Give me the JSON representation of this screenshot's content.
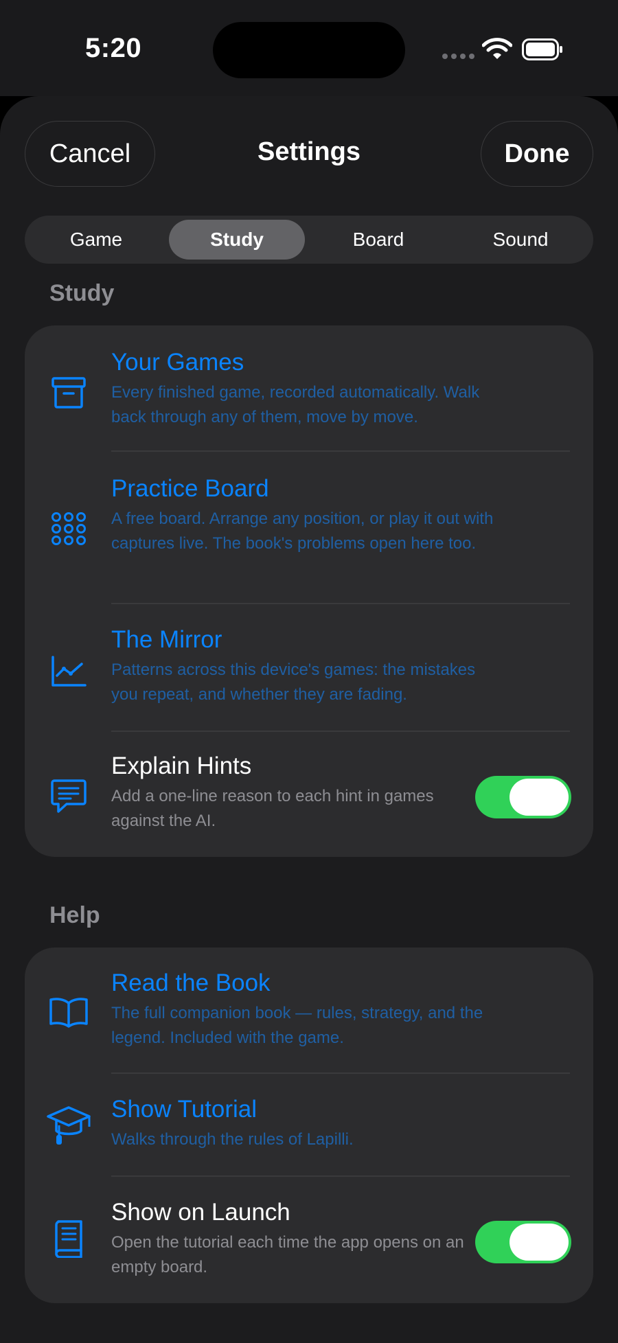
{
  "status": {
    "time": "5:20"
  },
  "nav": {
    "cancel": "Cancel",
    "title": "Settings",
    "done": "Done"
  },
  "tabs": [
    {
      "label": "Game"
    },
    {
      "label": "Study"
    },
    {
      "label": "Board"
    },
    {
      "label": "Sound"
    }
  ],
  "selected_tab": "Study",
  "study": {
    "header": "Study",
    "items": [
      {
        "icon": "archive-box-icon",
        "title": "Your Games",
        "desc": "Every finished game, recorded automatically. Walk back through any of them, move by move."
      },
      {
        "icon": "dot-grid-icon",
        "title": "Practice Board",
        "desc": "A free board. Arrange any position, or play it out with captures live. The book's problems open here too."
      },
      {
        "icon": "line-chart-icon",
        "title": "The Mirror",
        "desc": "Patterns across this device's games: the mistakes you repeat, and whether they are fading."
      },
      {
        "icon": "speech-bubble-icon",
        "title": "Explain Hints",
        "desc": "Add a one-line reason to each hint in games against the AI.",
        "toggle": true
      }
    ]
  },
  "help": {
    "header": "Help",
    "items": [
      {
        "icon": "open-book-icon",
        "title": "Read the Book",
        "desc": "The full companion book — rules, strategy, and the legend. Included with the game."
      },
      {
        "icon": "graduation-cap-icon",
        "title": "Show Tutorial",
        "desc": "Walks through the rules of Lapilli."
      },
      {
        "icon": "closed-book-icon",
        "title": "Show on Launch",
        "desc": "Open the tutorial each time the app opens on an empty board.",
        "toggle": true
      }
    ]
  },
  "colors": {
    "accent": "#0a84ff",
    "toggle_on": "#30d158",
    "background": "#1c1c1e",
    "card": "#2c2c2e"
  }
}
